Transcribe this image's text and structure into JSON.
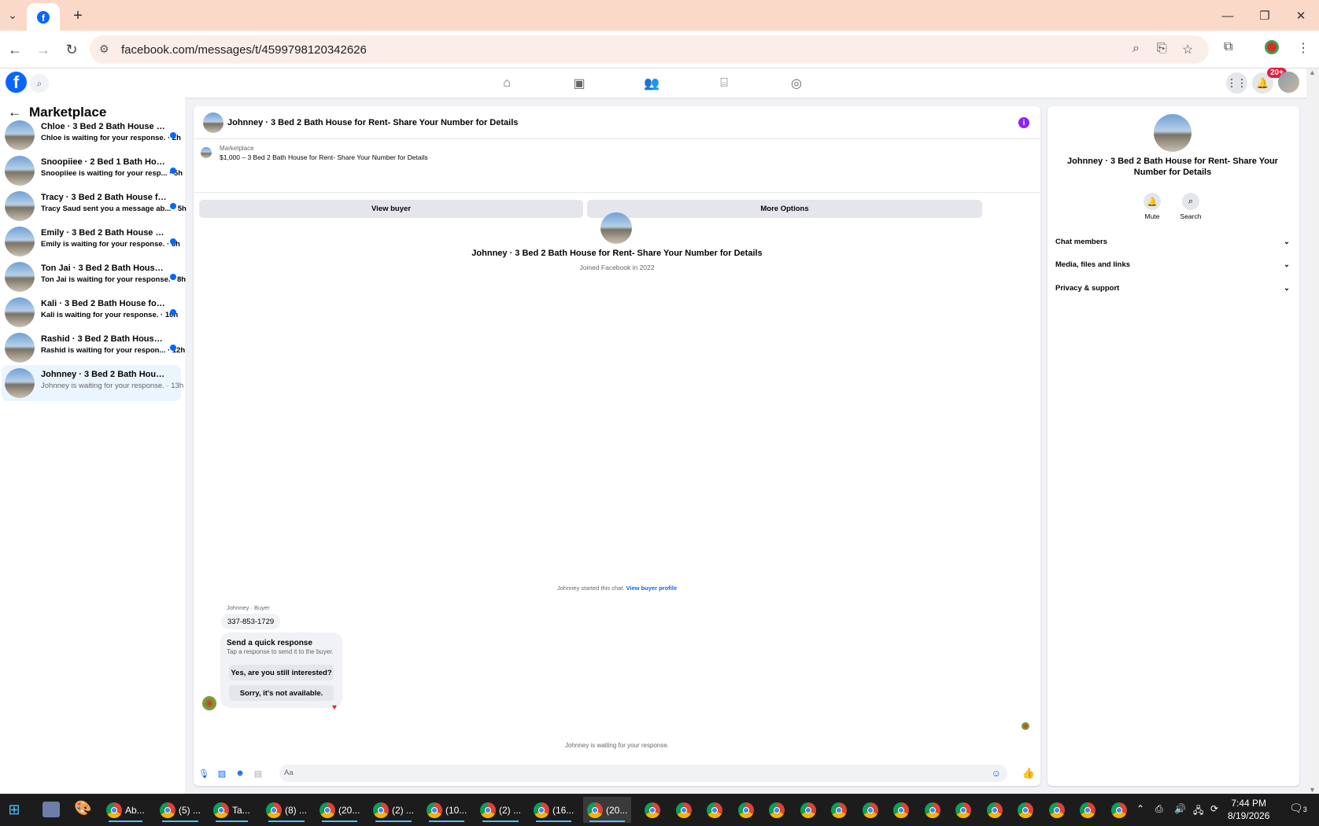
{
  "browser": {
    "url": "facebook.com/messages/t/4599798120342626",
    "notification_badge": "20+"
  },
  "sidebar": {
    "title": "Marketplace",
    "conversations": [
      {
        "title": "Chloe · 3 Bed 2 Bath House for R...",
        "preview": "Chloe is waiting for your response. · 2h",
        "unread": true
      },
      {
        "title": "Snoopiiee · 2 Bed 1 Bath House f...",
        "preview": "Snoopiiee is waiting for your resp... · 5h",
        "unread": true
      },
      {
        "title": "Tracy · 3 Bed 2 Bath House for R...",
        "preview": "Tracy Saud sent you a message ab... · 5h",
        "unread": true
      },
      {
        "title": "Emily · 3 Bed 2 Bath House for R...",
        "preview": "Emily is waiting for your response. · 6h",
        "unread": true
      },
      {
        "title": "Ton Jai · 3 Bed 2 Bath House for ...",
        "preview": "Ton Jai is waiting for your response. · 8h",
        "unread": true
      },
      {
        "title": "Kali · 3 Bed 2 Bath House for Ren...",
        "preview": "Kali is waiting for your response. · 10h",
        "unread": true
      },
      {
        "title": "Rashid · 3 Bed 2 Bath House for ...",
        "preview": "Rashid is waiting for your respon... · 12h",
        "unread": true
      },
      {
        "title": "Johnney · 3 Bed 2 Bath House for ...",
        "preview": "Johnney is waiting for your response. · 13h",
        "unread": false
      }
    ]
  },
  "chat": {
    "header_title": "Johnney · 3 Bed 2 Bath House for Rent- Share Your Number for Details",
    "marketplace_label": "Marketplace",
    "listing_price_title": "$1,000 – 3 Bed 2 Bath House for Rent- Share Your Number for Details",
    "view_buyer": "View buyer",
    "more_options": "More Options",
    "profile_name": "Johnney · 3 Bed 2 Bath House for Rent- Share Your Number for Details",
    "joined": "Joined Facebook in 2022",
    "started_text": "Johnney started this chat.",
    "view_buyer_profile": "View buyer profile",
    "sender_label": "Johnney · Buyer",
    "message": "337-853-1729",
    "quick_title": "Send a quick response",
    "quick_sub": "Tap a response to send it to the buyer.",
    "quick_1": "Yes, are you still interested?",
    "quick_2": "Sorry, it's not available.",
    "waiting": "Johnney is waiting for your response.",
    "input_placeholder": "Aa"
  },
  "details": {
    "name": "Johnney · 3 Bed 2 Bath House for Rent- Share Your Number for Details",
    "mute": "Mute",
    "search": "Search",
    "sections": [
      "Chat members",
      "Media, files and links",
      "Privacy & support"
    ]
  },
  "taskbar": {
    "apps": [
      "Ab...",
      "(5) ...",
      "Ta...",
      "(8) ...",
      "(20...",
      "(2) ...",
      "(10...",
      "(2) ...",
      "(16...",
      "(20..."
    ],
    "time": "7:44 PM",
    "date": "8/19/2026",
    "notifications": "3"
  },
  "colors": {
    "accent": "#0866ff",
    "tabstrip": "#fbd9c9",
    "info": "#8b24ff"
  }
}
